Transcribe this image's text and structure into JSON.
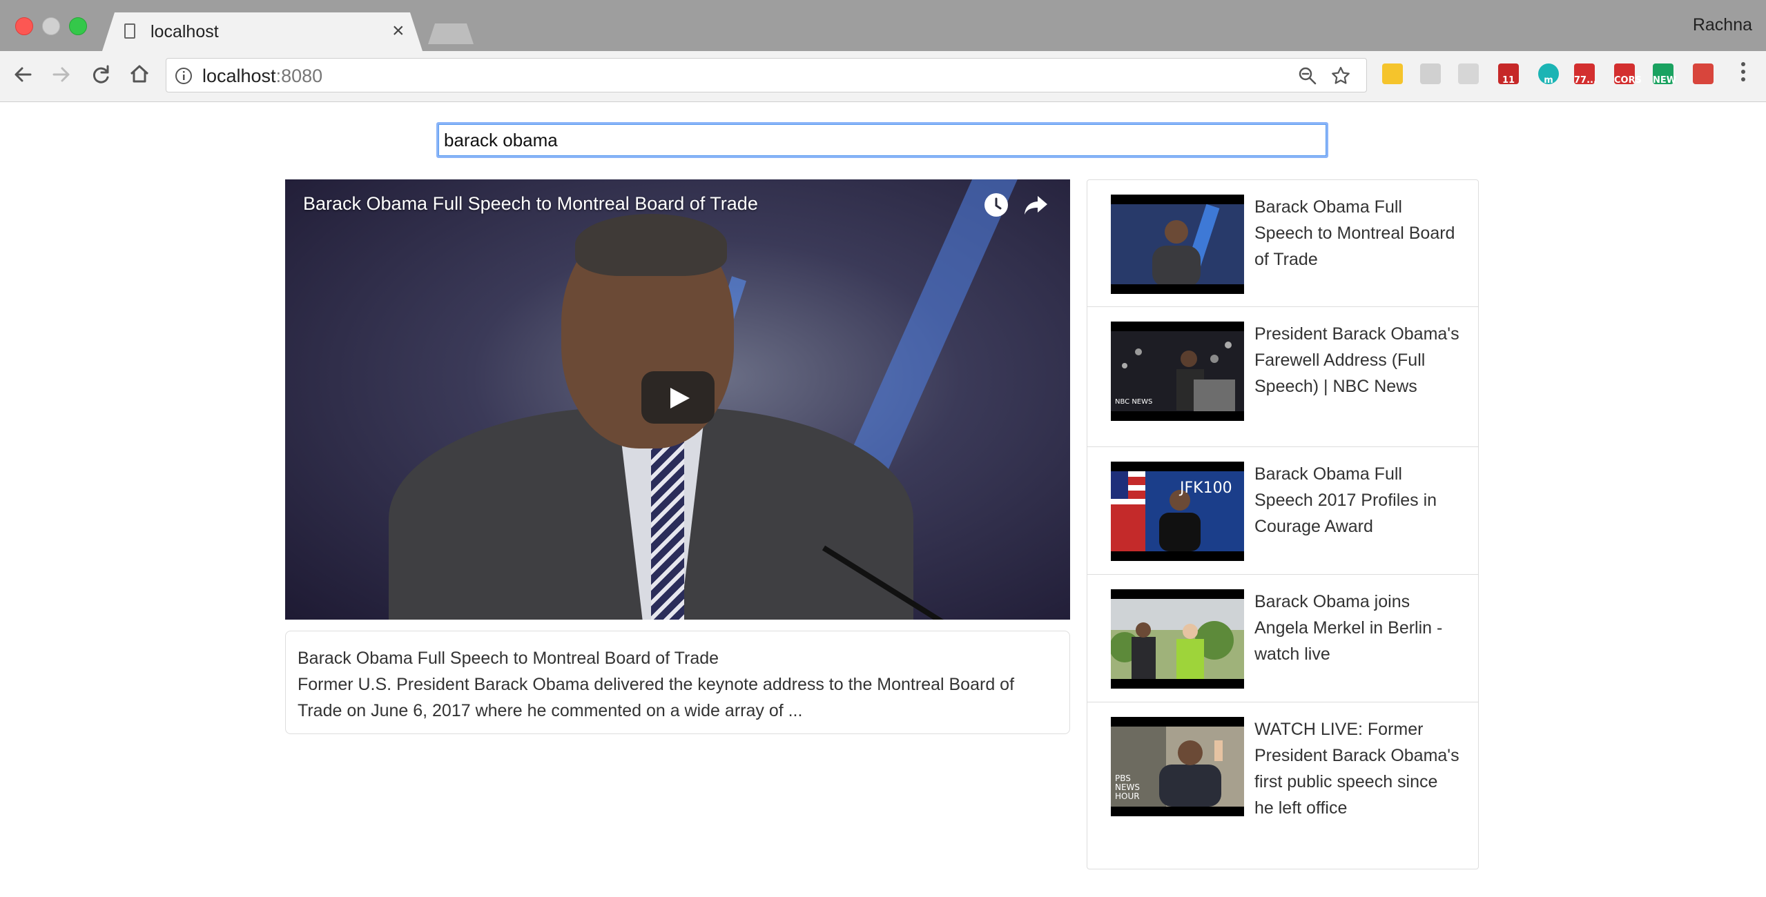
{
  "browser": {
    "tab_title": "localhost",
    "tab_close": "×",
    "profile_name": "Rachna",
    "url_host": "localhost",
    "url_port": ":8080",
    "extensions": [
      {
        "name": "evernote-icon",
        "label": "",
        "color": "#f5c42c"
      },
      {
        "name": "drive-icon",
        "label": "",
        "color": "#d0d0d0"
      },
      {
        "name": "swirl-icon",
        "label": "",
        "color": "#d6d6d6"
      },
      {
        "name": "calendar-icon",
        "label": "11",
        "color": "#c62828"
      },
      {
        "name": "m-icon",
        "label": "m",
        "color": "#1bb4b4"
      },
      {
        "name": "gmail-icon",
        "label": "77...",
        "color": "#d32f2f"
      },
      {
        "name": "cors-icon",
        "label": "CORS",
        "color": "#d32f2f"
      },
      {
        "name": "new-icon",
        "label": "NEW",
        "color": "#1aa260"
      },
      {
        "name": "photo-icon",
        "label": "",
        "color": "#d8453c"
      }
    ]
  },
  "search": {
    "value": "barack obama"
  },
  "player": {
    "title": "Barack Obama Full Speech to Montreal Board of Trade"
  },
  "details": {
    "title": "Barack Obama Full Speech to Montreal Board of Trade",
    "description": "Former U.S. President Barack Obama delivered the keynote address to the Montreal Board of Trade on June 6, 2017 where he commented on a wide array of ..."
  },
  "videos": [
    {
      "title": "Barack Obama Full Speech to Montreal Board of Trade"
    },
    {
      "title": "President Barack Obama's Farewell Address (Full Speech) | NBC News",
      "thumb_text": "NBC NEWS"
    },
    {
      "title": "Barack Obama Full Speech 2017 Profiles in Courage Award",
      "thumb_text": "JFK100"
    },
    {
      "title": "Barack Obama joins Angela Merkel in Berlin - watch live"
    },
    {
      "title": "WATCH LIVE: Former President Barack Obama's first public speech since he left office",
      "thumb_text": "PBS NEWS HOUR"
    }
  ],
  "colors": {
    "accent_focus": "#8ab4f8",
    "border": "#dddddd"
  }
}
